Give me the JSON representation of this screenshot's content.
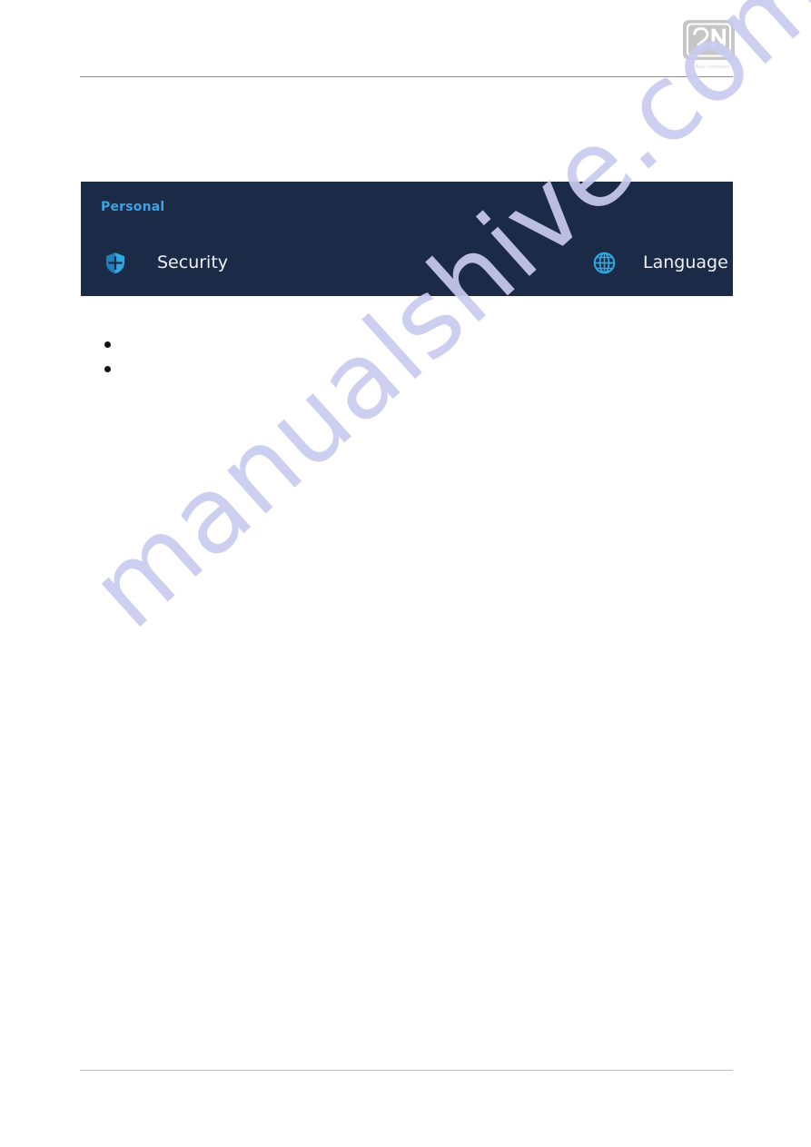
{
  "document": {
    "background_color": "#ffffff",
    "header_rule_color": "#8a8a8a",
    "footer_rule_color": "#bfbfbf"
  },
  "brand": {
    "name": "brand-logo",
    "wordmark": "2N",
    "tagline": "An Axis company",
    "mark_color": "#c6c6c6"
  },
  "watermark": {
    "text": "manualshive.com",
    "color": "#c9cbef"
  },
  "settings_panel": {
    "background_color": "#1b2b47",
    "accent_color": "#3fa2e0",
    "label_color": "#eef1f5",
    "section_title": "Personal",
    "rows": [
      {
        "icon": "shield-icon",
        "label": "Security"
      },
      {
        "icon": "globe-icon",
        "label": "Language &"
      }
    ]
  },
  "bullets": [
    {
      "text": ""
    },
    {
      "text": ""
    }
  ]
}
